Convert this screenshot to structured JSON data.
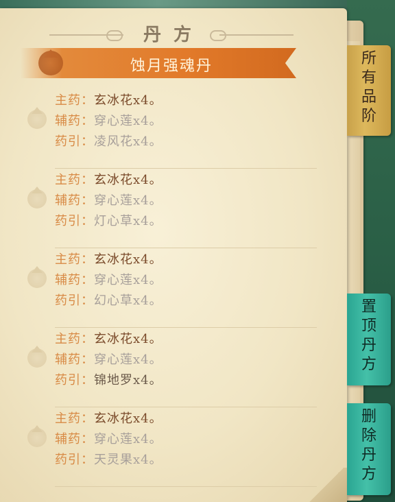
{
  "header": {
    "title": "丹方"
  },
  "banner": {
    "title": "蚀月强魂丹"
  },
  "labels": {
    "main": "主药：",
    "aux": "辅药：",
    "guide": "药引："
  },
  "recipes": [
    {
      "main": "玄冰花x4。",
      "aux": "穿心莲x4。",
      "guide": "凌风花x4。"
    },
    {
      "main": "玄冰花x4。",
      "aux": "穿心莲x4。",
      "guide": "灯心草x4。"
    },
    {
      "main": "玄冰花x4。",
      "aux": "穿心莲x4。",
      "guide": "幻心草x4。"
    },
    {
      "main": "玄冰花x4。",
      "aux": "穿心莲x4。",
      "guide": "锦地罗x4。"
    },
    {
      "main": "玄冰花x4。",
      "aux": "穿心莲x4。",
      "guide": "天灵果x4。"
    }
  ],
  "tabs": {
    "all": [
      "所",
      "有",
      "品",
      "阶"
    ],
    "pin": [
      "置",
      "顶",
      "丹",
      "方"
    ],
    "delete": [
      "删",
      "除",
      "丹",
      "方"
    ]
  },
  "colors": {
    "label": "#d88a45",
    "main_value": "#7a4a2a",
    "dim_value": "#a79f9a",
    "banner": "#e27a2a",
    "tab_gold": "#ddb85c",
    "tab_teal": "#44c0a8"
  }
}
